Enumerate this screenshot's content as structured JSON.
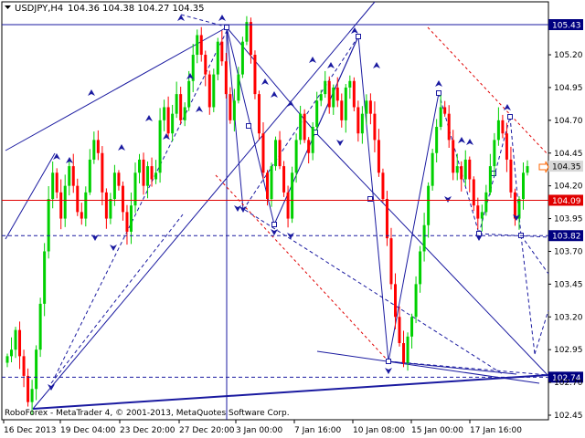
{
  "header": {
    "symbol_label": "USDJPY,H4",
    "ohlc": "104.36 104.38 104.27 104.35"
  },
  "footer": {
    "copyright": "RoboForex - MetaTrader 4, © 2001-2013, MetaQuotes Software Corp."
  },
  "colors": {
    "bull": "#00d000",
    "bear": "#ff0000",
    "line_blue": "#1a1aa0",
    "support_red": "#e00000",
    "tag_blue": "#000080",
    "tag_red": "#e00000",
    "grid": "#000000"
  },
  "chart_data": {
    "type": "candlestick",
    "symbol": "USDJPY",
    "timeframe": "H4",
    "y_ticks": [
      "105.20",
      "104.95",
      "104.70",
      "104.45",
      "104.20",
      "103.95",
      "103.70",
      "103.45",
      "103.20",
      "102.95",
      "102.70",
      "102.45"
    ],
    "x_ticks": [
      "16 Dec 2013",
      "19 Dec 04:00",
      "23 Dec 20:00",
      "27 Dec 20:00",
      "3 Jan 00:00",
      "7 Jan 16:00",
      "10 Jan 08:00",
      "15 Jan 00:00",
      "17 Jan 16:00"
    ],
    "ylim": [
      102.35,
      105.55
    ],
    "price_levels": [
      {
        "value": 105.43,
        "label": "105.43",
        "style": "solid",
        "color": "line_blue"
      },
      {
        "value": 104.35,
        "label": "104.35",
        "style": "current",
        "color": "grey"
      },
      {
        "value": 104.09,
        "label": "104.09",
        "style": "solid",
        "color": "support_red"
      },
      {
        "value": 103.82,
        "label": "103.82",
        "style": "dashed",
        "color": "line_blue"
      },
      {
        "value": 102.74,
        "label": "102.74",
        "style": "dashed",
        "color": "line_blue"
      }
    ],
    "closes": [
      102.9,
      102.95,
      103.1,
      102.9,
      102.75,
      102.55,
      102.65,
      102.95,
      103.3,
      103.7,
      104.1,
      104.3,
      104.15,
      103.95,
      104.2,
      104.35,
      104.2,
      104.0,
      103.95,
      104.15,
      104.4,
      104.55,
      104.45,
      104.15,
      103.95,
      104.1,
      104.3,
      104.2,
      104.0,
      103.85,
      104.05,
      104.3,
      104.4,
      104.2,
      104.35,
      104.25,
      104.3,
      104.7,
      104.8,
      104.6,
      104.75,
      104.9,
      104.7,
      104.8,
      105.0,
      105.2,
      105.35,
      105.2,
      105.05,
      104.8,
      105.05,
      105.3,
      105.15,
      104.9,
      104.7,
      104.85,
      105.05,
      105.3,
      105.45,
      105.2,
      104.9,
      104.6,
      104.3,
      104.1,
      104.35,
      104.55,
      104.35,
      104.15,
      103.95,
      104.3,
      104.55,
      104.75,
      104.55,
      104.45,
      104.65,
      104.85,
      104.9,
      105.0,
      104.8,
      104.95,
      104.85,
      104.7,
      104.95,
      105.0,
      104.8,
      104.6,
      104.75,
      104.85,
      104.75,
      104.55,
      104.3,
      104.1,
      103.8,
      103.45,
      103.2,
      103.0,
      102.85,
      103.05,
      103.2,
      103.45,
      103.7,
      103.9,
      104.2,
      104.45,
      104.65,
      104.8,
      104.75,
      104.55,
      104.3,
      104.35,
      104.25,
      104.4,
      104.25,
      104.05,
      103.95,
      104.0,
      104.15,
      104.35,
      104.55,
      104.7,
      104.6,
      104.4,
      104.15,
      103.95,
      104.1,
      104.3,
      104.35
    ],
    "series": []
  }
}
